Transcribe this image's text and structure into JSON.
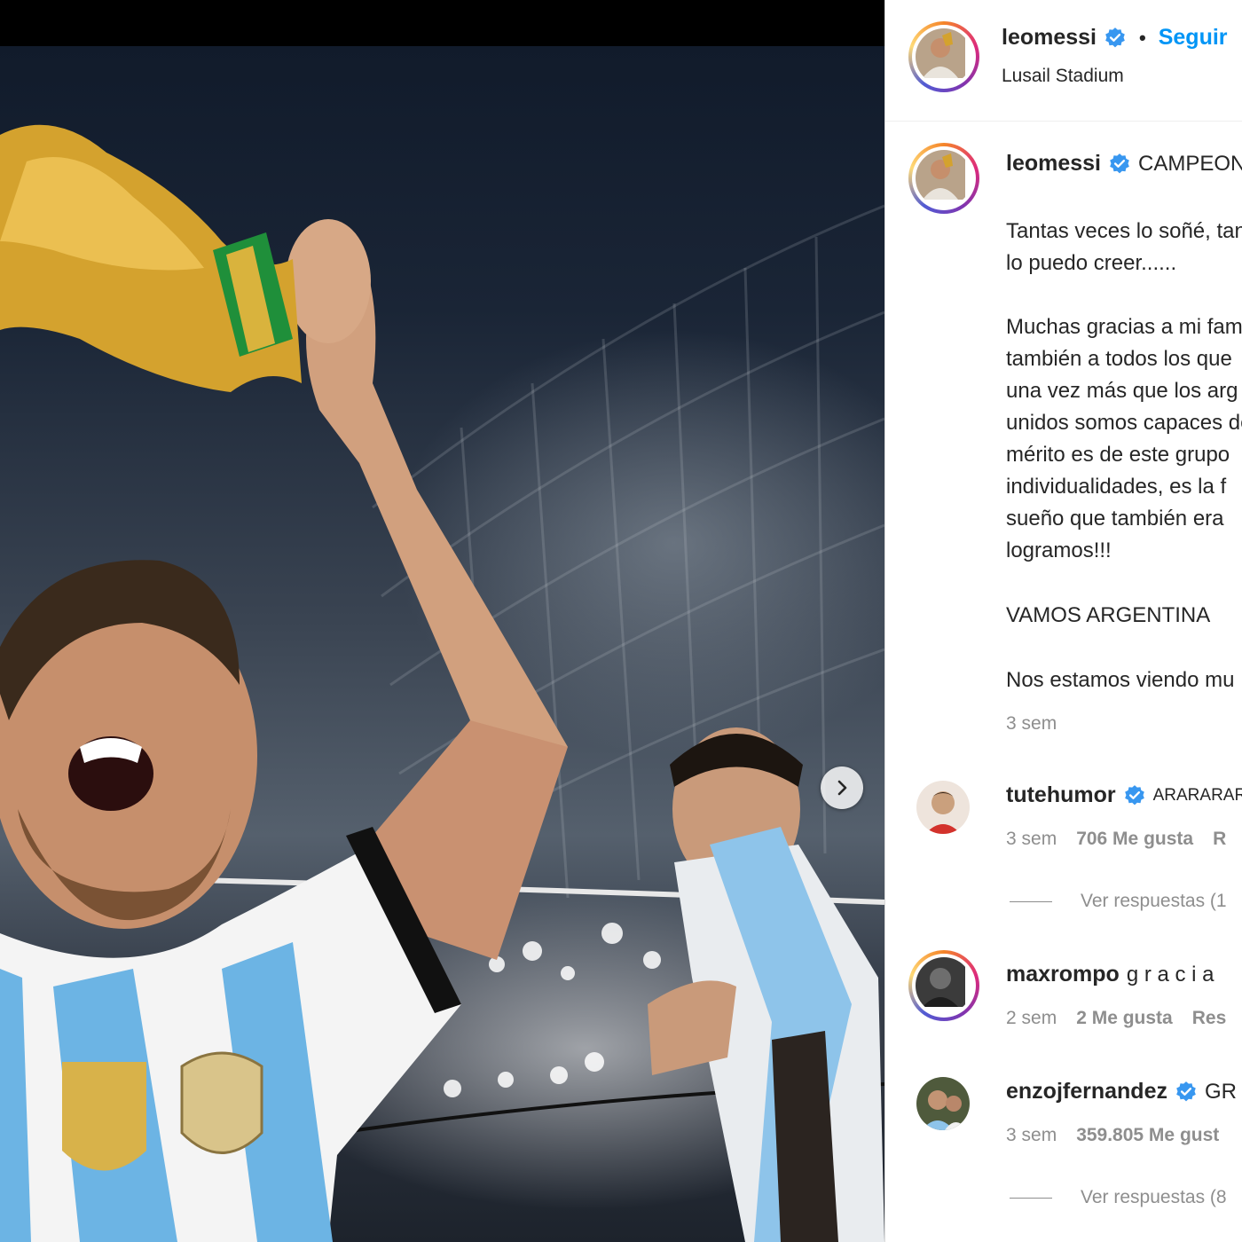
{
  "post": {
    "username": "leomessi",
    "follow_label": "Seguir",
    "separator": "•",
    "location": "Lusail Stadium"
  },
  "caption": {
    "username": "leomessi",
    "headline": "CAMPEONES",
    "lines": [
      "Tantas veces lo soñé, tanto",
      "lo puedo creer......",
      "Muchas gracias a mi fam",
      "también a todos los que",
      "una vez más que los arg",
      "unidos somos capaces de",
      "mérito es de este grupo",
      "individualidades, es la f",
      "sueño que también era",
      "logramos!!!",
      "VAMOS ARGENTINA ",
      "Nos estamos viendo mu"
    ],
    "time": "3 sem"
  },
  "comments": [
    {
      "username": "tutehumor",
      "text": "ARARARARA",
      "time": "3 sem",
      "likes": "706 Me gusta",
      "reply": "R",
      "view_replies": "Ver respuestas (1"
    },
    {
      "username": "maxrompo",
      "text": "g r a c i a",
      "time": "2 sem",
      "likes": "2 Me gusta",
      "reply": "Res"
    },
    {
      "username": "enzojfernandez",
      "text": "GR",
      "time": "3 sem",
      "likes": "359.805 Me gust",
      "view_replies": "Ver respuestas (8"
    }
  ],
  "icons": {
    "verified": "verified-badge-icon",
    "carousel": "chevron-right-icon"
  },
  "colors": {
    "link_blue": "#0095f6",
    "verified_blue": "#3897f0",
    "text": "#262626",
    "muted": "#8e8e8e",
    "jersey_blue": "#6cb4e4",
    "trophy_gold": "#d4a22e"
  }
}
